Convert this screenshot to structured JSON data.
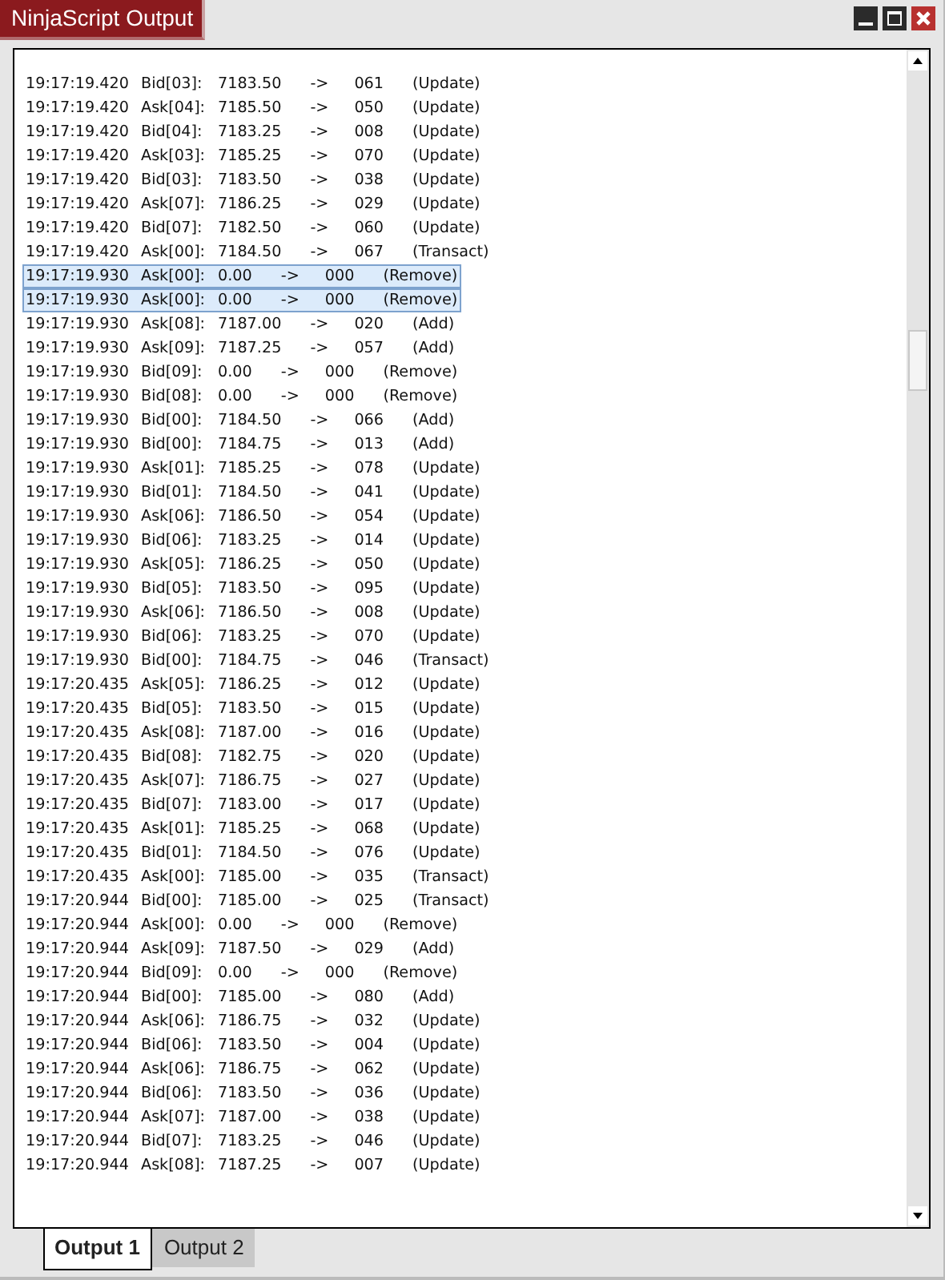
{
  "window": {
    "title": "NinjaScript Output"
  },
  "rows": [
    {
      "time": "19:17:19.420",
      "level": "Bid[03]:",
      "price": "7183.50",
      "arrow": "->",
      "size": "061",
      "action": "(Update)",
      "selected": false
    },
    {
      "time": "19:17:19.420",
      "level": "Ask[04]:",
      "price": "7185.50",
      "arrow": "->",
      "size": "050",
      "action": "(Update)",
      "selected": false
    },
    {
      "time": "19:17:19.420",
      "level": "Bid[04]:",
      "price": "7183.25",
      "arrow": "->",
      "size": "008",
      "action": "(Update)",
      "selected": false
    },
    {
      "time": "19:17:19.420",
      "level": "Ask[03]:",
      "price": "7185.25",
      "arrow": "->",
      "size": "070",
      "action": "(Update)",
      "selected": false
    },
    {
      "time": "19:17:19.420",
      "level": "Bid[03]:",
      "price": "7183.50",
      "arrow": "->",
      "size": "038",
      "action": "(Update)",
      "selected": false
    },
    {
      "time": "19:17:19.420",
      "level": "Ask[07]:",
      "price": "7186.25",
      "arrow": "->",
      "size": "029",
      "action": "(Update)",
      "selected": false
    },
    {
      "time": "19:17:19.420",
      "level": "Bid[07]:",
      "price": "7182.50",
      "arrow": "->",
      "size": "060",
      "action": "(Update)",
      "selected": false
    },
    {
      "time": "19:17:19.420",
      "level": "Ask[00]:",
      "price": "7184.50",
      "arrow": "->",
      "size": "067",
      "action": "(Transact)",
      "selected": false
    },
    {
      "time": "19:17:19.930",
      "level": "Ask[00]:",
      "price": "0.00",
      "arrow": "->",
      "size": "000",
      "action": "(Remove)",
      "selected": true
    },
    {
      "time": "19:17:19.930",
      "level": "Ask[00]:",
      "price": "0.00",
      "arrow": "->",
      "size": "000",
      "action": "(Remove)",
      "selected": true
    },
    {
      "time": "19:17:19.930",
      "level": "Ask[08]:",
      "price": "7187.00",
      "arrow": "->",
      "size": "020",
      "action": "(Add)",
      "selected": false
    },
    {
      "time": "19:17:19.930",
      "level": "Ask[09]:",
      "price": "7187.25",
      "arrow": "->",
      "size": "057",
      "action": "(Add)",
      "selected": false
    },
    {
      "time": "19:17:19.930",
      "level": "Bid[09]:",
      "price": "0.00",
      "arrow": "->",
      "size": "000",
      "action": "(Remove)",
      "selected": false
    },
    {
      "time": "19:17:19.930",
      "level": "Bid[08]:",
      "price": "0.00",
      "arrow": "->",
      "size": "000",
      "action": "(Remove)",
      "selected": false
    },
    {
      "time": "19:17:19.930",
      "level": "Bid[00]:",
      "price": "7184.50",
      "arrow": "->",
      "size": "066",
      "action": "(Add)",
      "selected": false
    },
    {
      "time": "19:17:19.930",
      "level": "Bid[00]:",
      "price": "7184.75",
      "arrow": "->",
      "size": "013",
      "action": "(Add)",
      "selected": false
    },
    {
      "time": "19:17:19.930",
      "level": "Ask[01]:",
      "price": "7185.25",
      "arrow": "->",
      "size": "078",
      "action": "(Update)",
      "selected": false
    },
    {
      "time": "19:17:19.930",
      "level": "Bid[01]:",
      "price": "7184.50",
      "arrow": "->",
      "size": "041",
      "action": "(Update)",
      "selected": false
    },
    {
      "time": "19:17:19.930",
      "level": "Ask[06]:",
      "price": "7186.50",
      "arrow": "->",
      "size": "054",
      "action": "(Update)",
      "selected": false
    },
    {
      "time": "19:17:19.930",
      "level": "Bid[06]:",
      "price": "7183.25",
      "arrow": "->",
      "size": "014",
      "action": "(Update)",
      "selected": false
    },
    {
      "time": "19:17:19.930",
      "level": "Ask[05]:",
      "price": "7186.25",
      "arrow": "->",
      "size": "050",
      "action": "(Update)",
      "selected": false
    },
    {
      "time": "19:17:19.930",
      "level": "Bid[05]:",
      "price": "7183.50",
      "arrow": "->",
      "size": "095",
      "action": "(Update)",
      "selected": false
    },
    {
      "time": "19:17:19.930",
      "level": "Ask[06]:",
      "price": "7186.50",
      "arrow": "->",
      "size": "008",
      "action": "(Update)",
      "selected": false
    },
    {
      "time": "19:17:19.930",
      "level": "Bid[06]:",
      "price": "7183.25",
      "arrow": "->",
      "size": "070",
      "action": "(Update)",
      "selected": false
    },
    {
      "time": "19:17:19.930",
      "level": "Bid[00]:",
      "price": "7184.75",
      "arrow": "->",
      "size": "046",
      "action": "(Transact)",
      "selected": false
    },
    {
      "time": "19:17:20.435",
      "level": "Ask[05]:",
      "price": "7186.25",
      "arrow": "->",
      "size": "012",
      "action": "(Update)",
      "selected": false
    },
    {
      "time": "19:17:20.435",
      "level": "Bid[05]:",
      "price": "7183.50",
      "arrow": "->",
      "size": "015",
      "action": "(Update)",
      "selected": false
    },
    {
      "time": "19:17:20.435",
      "level": "Ask[08]:",
      "price": "7187.00",
      "arrow": "->",
      "size": "016",
      "action": "(Update)",
      "selected": false
    },
    {
      "time": "19:17:20.435",
      "level": "Bid[08]:",
      "price": "7182.75",
      "arrow": "->",
      "size": "020",
      "action": "(Update)",
      "selected": false
    },
    {
      "time": "19:17:20.435",
      "level": "Ask[07]:",
      "price": "7186.75",
      "arrow": "->",
      "size": "027",
      "action": "(Update)",
      "selected": false
    },
    {
      "time": "19:17:20.435",
      "level": "Bid[07]:",
      "price": "7183.00",
      "arrow": "->",
      "size": "017",
      "action": "(Update)",
      "selected": false
    },
    {
      "time": "19:17:20.435",
      "level": "Ask[01]:",
      "price": "7185.25",
      "arrow": "->",
      "size": "068",
      "action": "(Update)",
      "selected": false
    },
    {
      "time": "19:17:20.435",
      "level": "Bid[01]:",
      "price": "7184.50",
      "arrow": "->",
      "size": "076",
      "action": "(Update)",
      "selected": false
    },
    {
      "time": "19:17:20.435",
      "level": "Ask[00]:",
      "price": "7185.00",
      "arrow": "->",
      "size": "035",
      "action": "(Transact)",
      "selected": false
    },
    {
      "time": "19:17:20.944",
      "level": "Bid[00]:",
      "price": "7185.00",
      "arrow": "->",
      "size": "025",
      "action": "(Transact)",
      "selected": false
    },
    {
      "time": "19:17:20.944",
      "level": "Ask[00]:",
      "price": "0.00",
      "arrow": "->",
      "size": "000",
      "action": "(Remove)",
      "selected": false
    },
    {
      "time": "19:17:20.944",
      "level": "Ask[09]:",
      "price": "7187.50",
      "arrow": "->",
      "size": "029",
      "action": "(Add)",
      "selected": false
    },
    {
      "time": "19:17:20.944",
      "level": "Bid[09]:",
      "price": "0.00",
      "arrow": "->",
      "size": "000",
      "action": "(Remove)",
      "selected": false
    },
    {
      "time": "19:17:20.944",
      "level": "Bid[00]:",
      "price": "7185.00",
      "arrow": "->",
      "size": "080",
      "action": "(Add)",
      "selected": false
    },
    {
      "time": "19:17:20.944",
      "level": "Ask[06]:",
      "price": "7186.75",
      "arrow": "->",
      "size": "032",
      "action": "(Update)",
      "selected": false
    },
    {
      "time": "19:17:20.944",
      "level": "Bid[06]:",
      "price": "7183.50",
      "arrow": "->",
      "size": "004",
      "action": "(Update)",
      "selected": false
    },
    {
      "time": "19:17:20.944",
      "level": "Ask[06]:",
      "price": "7186.75",
      "arrow": "->",
      "size": "062",
      "action": "(Update)",
      "selected": false
    },
    {
      "time": "19:17:20.944",
      "level": "Bid[06]:",
      "price": "7183.50",
      "arrow": "->",
      "size": "036",
      "action": "(Update)",
      "selected": false
    },
    {
      "time": "19:17:20.944",
      "level": "Ask[07]:",
      "price": "7187.00",
      "arrow": "->",
      "size": "038",
      "action": "(Update)",
      "selected": false
    },
    {
      "time": "19:17:20.944",
      "level": "Bid[07]:",
      "price": "7183.25",
      "arrow": "->",
      "size": "046",
      "action": "(Update)",
      "selected": false
    },
    {
      "time": "19:17:20.944",
      "level": "Ask[08]:",
      "price": "7187.25",
      "arrow": "->",
      "size": "007",
      "action": "(Update)",
      "selected": false
    }
  ],
  "tabs": [
    {
      "label": "Output 1",
      "selected": true
    },
    {
      "label": "Output 2",
      "selected": false
    }
  ]
}
